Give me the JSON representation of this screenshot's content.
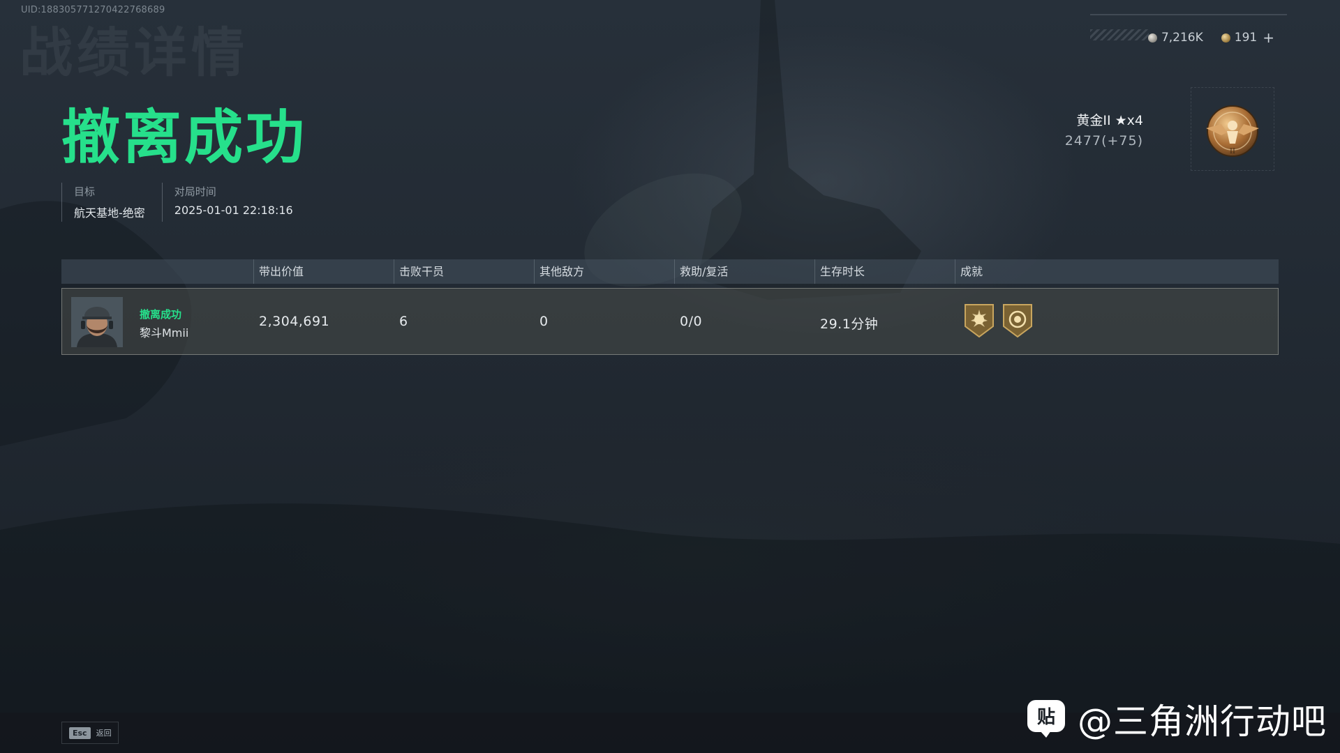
{
  "uid": "UID:188305771270422768689",
  "page_heading": "战绩详情",
  "currency": [
    {
      "icon": "silver-coin-icon",
      "value": "7,216K"
    },
    {
      "icon": "gold-coin-icon",
      "value": "191"
    }
  ],
  "currency_add_label": "+",
  "result_title": "撤离成功",
  "meta": {
    "target_label": "目标",
    "target_value": "航天基地-绝密",
    "time_label": "对局时间",
    "time_value": "2025-01-01 22:18:16"
  },
  "rank": {
    "name": "黄金II ★x4",
    "score": "2477(+75)",
    "badge_icon": "eagle-rank-badge-icon",
    "badge_numeral": "II"
  },
  "table": {
    "headers": [
      "带出价值",
      "击败干员",
      "其他敌方",
      "救助/复活",
      "生存时长",
      "成就"
    ],
    "rows": [
      {
        "status": "撤离成功",
        "player": "黎斗Mmii",
        "value": "2,304,691",
        "kills": "6",
        "other_enemies": "0",
        "assist_revive": "0/0",
        "survival": "29.1分钟",
        "achievements": [
          "sun-emblem-icon",
          "target-emblem-icon"
        ]
      }
    ]
  },
  "footer": {
    "esc_key": "Esc",
    "esc_label": "返回"
  },
  "watermark": {
    "icon_glyph": "贴",
    "text": "@三角洲行动吧"
  },
  "colors": {
    "success_green": "#26e08b",
    "background": "#222a33"
  }
}
